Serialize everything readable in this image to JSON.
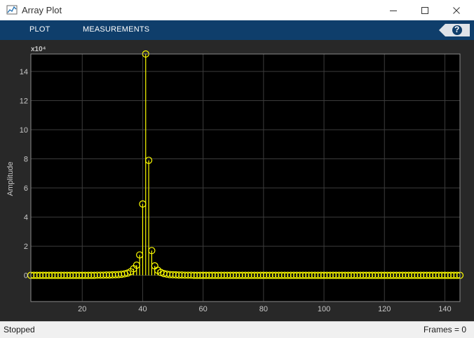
{
  "window": {
    "title": "Array Plot"
  },
  "toolstrip": {
    "tabs": [
      "PLOT",
      "MEASUREMENTS"
    ],
    "help_label": "?"
  },
  "status": {
    "left": "Stopped",
    "right": "Frames = 0"
  },
  "colors": {
    "trace": "#ffff00",
    "axes_bg": "#000000",
    "figure_bg": "#282828",
    "toolstrip": "#0f3e6b"
  },
  "chart_data": {
    "type": "stem",
    "ylabel": "Amplitude",
    "y_exponent_label": "x10⁴",
    "y_scale": 10000,
    "xlim": [
      3,
      145
    ],
    "ylim": [
      -1.8,
      15.2
    ],
    "xticks": [
      20,
      40,
      60,
      80,
      100,
      120,
      140
    ],
    "yticks": [
      0,
      2,
      4,
      6,
      8,
      10,
      12,
      14
    ],
    "grid": true,
    "x": [
      1,
      2,
      3,
      4,
      5,
      6,
      7,
      8,
      9,
      10,
      11,
      12,
      13,
      14,
      15,
      16,
      17,
      18,
      19,
      20,
      21,
      22,
      23,
      24,
      25,
      26,
      27,
      28,
      29,
      30,
      31,
      32,
      33,
      34,
      35,
      36,
      37,
      38,
      39,
      40,
      41,
      42,
      43,
      44,
      45,
      46,
      47,
      48,
      49,
      50,
      51,
      52,
      53,
      54,
      55,
      56,
      57,
      58,
      59,
      60,
      61,
      62,
      63,
      64,
      65,
      66,
      67,
      68,
      69,
      70,
      71,
      72,
      73,
      74,
      75,
      76,
      77,
      78,
      79,
      80,
      81,
      82,
      83,
      84,
      85,
      86,
      87,
      88,
      89,
      90,
      91,
      92,
      93,
      94,
      95,
      96,
      97,
      98,
      99,
      100,
      101,
      102,
      103,
      104,
      105,
      106,
      107,
      108,
      109,
      110,
      111,
      112,
      113,
      114,
      115,
      116,
      117,
      118,
      119,
      120,
      121,
      122,
      123,
      124,
      125,
      126,
      127,
      128,
      129,
      130,
      131,
      132,
      133,
      134,
      135,
      136,
      137,
      138,
      139,
      140,
      141,
      142,
      143,
      144,
      145
    ],
    "y": [
      0,
      0,
      0,
      0,
      0,
      0,
      0,
      0,
      0,
      0,
      0,
      0,
      0,
      0,
      0,
      0,
      0,
      0,
      0,
      0,
      0,
      0,
      0,
      0,
      0.01,
      0.01,
      0.01,
      0.02,
      0.02,
      0.03,
      0.04,
      0.05,
      0.07,
      0.1,
      0.15,
      0.25,
      0.45,
      0.7,
      1.4,
      4.9,
      15.2,
      7.9,
      1.7,
      0.65,
      0.35,
      0.2,
      0.12,
      0.08,
      0.05,
      0.04,
      0.03,
      0.02,
      0.02,
      0.01,
      0.01,
      0.01,
      0,
      0,
      0,
      0,
      0,
      0,
      0,
      0,
      0,
      0,
      0,
      0,
      0,
      0,
      0,
      0,
      0,
      0,
      0,
      0,
      0,
      0,
      0,
      0,
      0,
      0,
      0,
      0,
      0,
      0,
      0,
      0,
      0,
      0,
      0,
      0,
      0,
      0,
      0,
      0,
      0,
      0,
      0,
      0,
      0,
      0,
      0,
      0,
      0,
      0,
      0,
      0,
      0,
      0,
      0,
      0,
      0,
      0,
      0,
      0,
      0,
      0,
      0,
      0,
      0,
      0,
      0,
      0,
      0,
      0,
      0,
      0,
      0,
      0,
      0,
      0,
      0,
      0,
      0,
      0,
      0,
      0,
      0,
      0,
      0,
      0,
      0,
      0,
      0
    ]
  }
}
